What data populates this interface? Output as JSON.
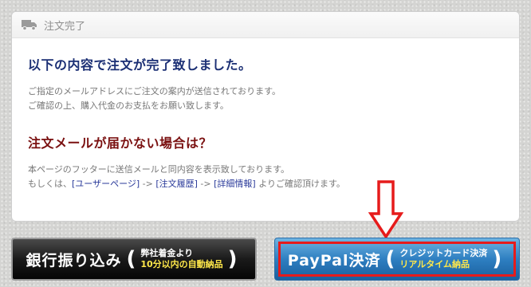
{
  "panel": {
    "title": "注文完了",
    "heading": "以下の内容で注文が完了致しました。",
    "message_line1": "ご指定のメールアドレスにご注文の案内が送信されております。",
    "message_line2": "ご確認の上、購入代金のお支払をお願い致します。",
    "subheading": "注文メールが届かない場合は？",
    "info_line1": "本ページのフッターに送信メールと同内容を表示致しております。",
    "info_line2_prefix": "もしくは、",
    "link_user_page": "[ユーザーページ]",
    "separator1": " -> ",
    "link_order_history": "[注文履歴]",
    "separator2": " -> ",
    "link_details": "[詳細情報]",
    "info_line2_suffix": " よりご確認頂けます。"
  },
  "buttons": {
    "bank": {
      "label": "銀行振り込み",
      "open_paren": "(",
      "sub1": "弊社着金より",
      "sub2": "10分以内の自動納品",
      "close_paren": ")"
    },
    "paypal": {
      "label": "PayPal決済",
      "open_paren": "(",
      "sub1": "クレジットカード決済",
      "sub2": "リアルタイム納品",
      "close_paren": ")"
    }
  },
  "icons": {
    "header": "truck-icon",
    "annotation": "down-arrow-icon"
  },
  "colors": {
    "heading_blue": "#1b2f74",
    "heading_red": "#7a1010",
    "highlight_red": "#e61b1b",
    "accent_yellow": "#ffe84a"
  }
}
